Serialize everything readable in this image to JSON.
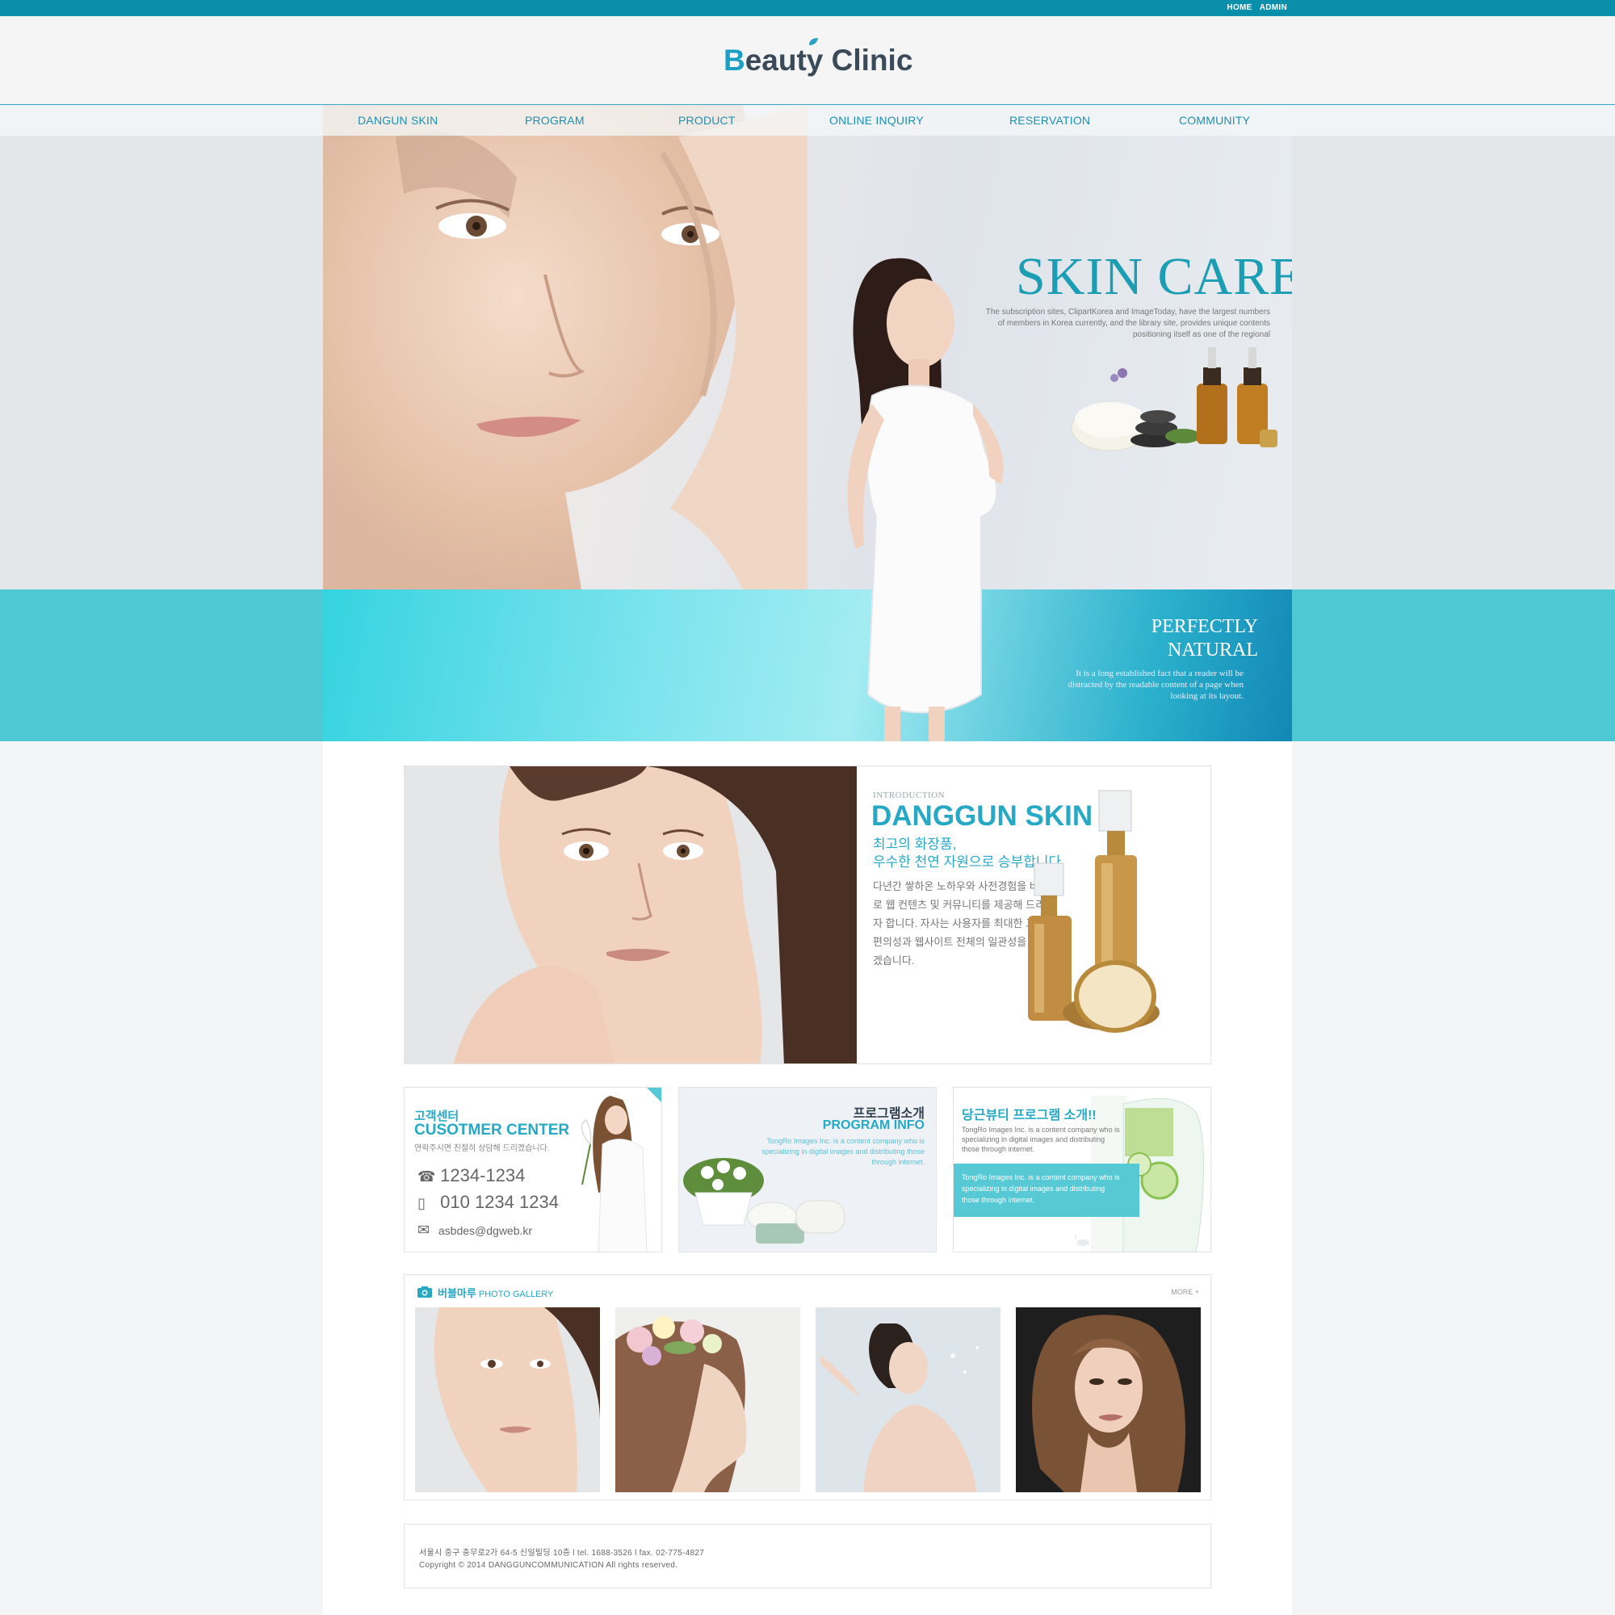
{
  "topbar": {
    "links": [
      "HOME",
      "ADMIN"
    ]
  },
  "header": {
    "logo_first": "B",
    "logo_rest": "eauty",
    "logo_second": "Clinic"
  },
  "nav": {
    "items": [
      "DANGUN SKIN",
      "PROGRAM",
      "PRODUCT",
      "ONLINE INQUIRY",
      "RESERVATION",
      "COMMUNITY"
    ]
  },
  "hero": {
    "title": "SKIN CARE",
    "description": "The subscription sites, ClipartKorea and ImageToday, have the largest numbers of members in Korea currently, and the library site, provides unique contents positioning itself as one of the regional",
    "perfect_line1": "PERFECTLY",
    "perfect_line2": "NATURAL",
    "perfect_desc": "It is a long established fact that a reader will be distracted by the readable content of a page when looking at its layout."
  },
  "intro": {
    "kicker": "INTRODUCTION",
    "title": "DANGGUN SKIN",
    "headline1": "최고의 화장품,",
    "headline2": "우수한 천연 자원으로 승부합니다.",
    "body": "다년간 쌓하온 노하우와 사전경험을 바탕으로 웹 컨텐츠 및 커뮤니티를 제공해 드리고자 합니다. 자사는 사용자를 최대한 고려한 편의성과 웹사이트 전체의 일관성을 유지하겠습니다."
  },
  "customer": {
    "title_ko": "고객센터",
    "title_en": "CUSOTMER CENTER",
    "subtitle": "연락주시면 친절히 상담해 드리겠습니다.",
    "phone": "1234-1234",
    "mobile": "010 1234 1234",
    "email": "asbdes@dgweb.kr"
  },
  "program": {
    "title_ko": "프로그램소개",
    "title_en": "PROGRAM INFO",
    "desc": "TongRo Images Inc. is a content company who is specializing in digital images and distributing those through internet."
  },
  "dangun": {
    "title": "당근뷰티 프로그램 소개!!",
    "desc": "TongRo Images Inc. is a content company who is specializing in digital images and distributing those through internet.",
    "strip": "TongRo Images Inc. is a content company who is specializing in digital images and distributing those through internet."
  },
  "gallery": {
    "title_ko": "버블마루",
    "title_en": "PHOTO GALLERY",
    "more": "MORE +"
  },
  "footer": {
    "address": "서울시 중구 충무로2가 64-5 신일빌딩 10층 l tel. 1688-3526 l fax. 02-775-4827",
    "copyright": "Copyright © 2014 DANGGUNCOMMUNICATION All rights reserved."
  },
  "colors": {
    "accent": "#27a9c6",
    "topbar": "#0a8fab",
    "band": "#4ec9d3"
  }
}
